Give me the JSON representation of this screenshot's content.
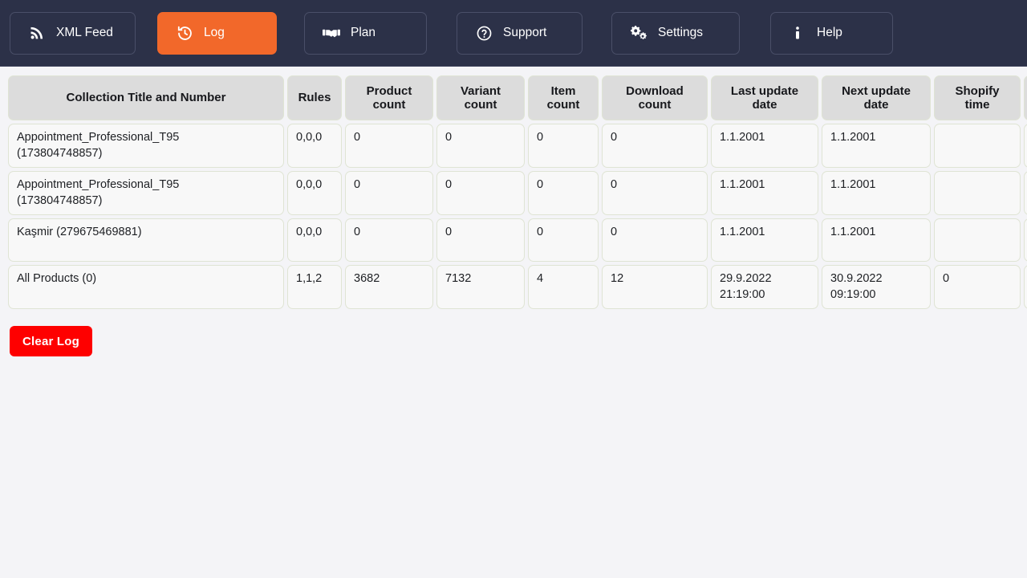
{
  "nav": {
    "items": [
      {
        "id": "xml-feed",
        "label": "XML Feed",
        "icon": "rss-icon",
        "active": false
      },
      {
        "id": "log",
        "label": "Log",
        "icon": "history-clock-icon",
        "active": true
      },
      {
        "id": "plan",
        "label": "Plan",
        "icon": "handshake-icon",
        "active": false
      },
      {
        "id": "support",
        "label": "Support",
        "icon": "question-circle-icon",
        "active": false
      },
      {
        "id": "settings",
        "label": "Settings",
        "icon": "gears-icon",
        "active": false
      },
      {
        "id": "help",
        "label": "Help",
        "icon": "info-icon",
        "active": false
      }
    ],
    "active_color": "#f2682a",
    "bar_color": "#2c3148"
  },
  "table": {
    "headers": [
      "Collection Title and Number",
      "Rules",
      "Product\ncount",
      "Variant\ncount",
      "Item\ncount",
      "Download\ncount",
      "Last update\ndate",
      "Next update\ndate",
      "Shopify\ntime",
      ""
    ],
    "rows": [
      {
        "title": "Appointment_Professional_T95\n(173804748857)",
        "rules": "0,0,0",
        "product_count": "0",
        "variant_count": "0",
        "item_count": "0",
        "download_count": "0",
        "last_update_date": "1.1.2001",
        "next_update_date": "1.1.2001",
        "shopify_time": "",
        "extra": ""
      },
      {
        "title": "Appointment_Professional_T95\n(173804748857)",
        "rules": "0,0,0",
        "product_count": "0",
        "variant_count": "0",
        "item_count": "0",
        "download_count": "0",
        "last_update_date": "1.1.2001",
        "next_update_date": "1.1.2001",
        "shopify_time": "",
        "extra": ""
      },
      {
        "title": "Kaşmir (279675469881)",
        "rules": "0,0,0",
        "product_count": "0",
        "variant_count": "0",
        "item_count": "0",
        "download_count": "0",
        "last_update_date": "1.1.2001",
        "next_update_date": "1.1.2001",
        "shopify_time": "",
        "extra": ""
      },
      {
        "title": "All Products (0)",
        "rules": "1,1,2",
        "product_count": "3682",
        "variant_count": "7132",
        "item_count": "4",
        "download_count": "12",
        "last_update_date": "29.9.2022\n21:19:00",
        "next_update_date": "30.9.2022\n09:19:00",
        "shopify_time": "0",
        "extra": ""
      }
    ]
  },
  "actions": {
    "clear_log_label": "Clear Log",
    "clear_log_color": "#fe0000"
  }
}
